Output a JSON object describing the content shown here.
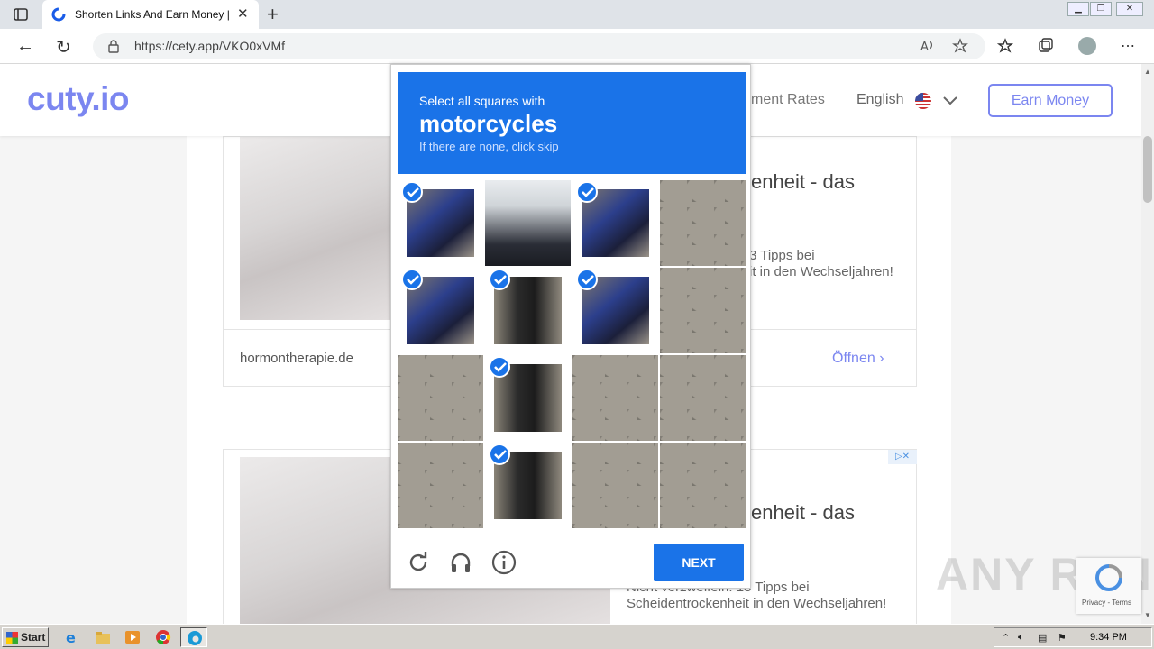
{
  "browser": {
    "tab_title": "Shorten Links And Earn Money | c",
    "url": "https://cety.app/VKO0xVMf",
    "window_controls": [
      "minimize-icon",
      "restore-icon",
      "close-icon"
    ]
  },
  "site": {
    "logo": "cuty.io",
    "nav_rates": "ment Rates",
    "nav_language": "English",
    "earn_button": "Earn Money",
    "brand_color": "#7b86f0"
  },
  "ads": [
    {
      "headline": "enheit - das",
      "text_line1": "3 Tipps bei",
      "text_line2": "it in den Wechseljahren!",
      "domain": "hormontherapie.de",
      "open_label": "Öffnen"
    },
    {
      "headline": "enheit - das",
      "text_line1": "Nicht verzweifeln: 13 Tipps bei",
      "text_line2": "Scheidentrockenheit in den Wechseljahren!"
    }
  ],
  "captcha": {
    "instruction": "Select all squares with",
    "target": "motorcycles",
    "hint": "If there are none, click skip",
    "next_button": "NEXT",
    "accent_color": "#1a73e8",
    "selected_tiles": [
      [
        0,
        0
      ],
      [
        0,
        2
      ],
      [
        1,
        0
      ],
      [
        1,
        1
      ],
      [
        1,
        2
      ],
      [
        2,
        1
      ],
      [
        3,
        1
      ]
    ],
    "footer_icons": [
      "reload-icon",
      "audio-icon",
      "info-icon"
    ]
  },
  "overlay": {
    "watermark": "ANY RUN",
    "recaptcha_links": "Privacy - Terms"
  },
  "taskbar": {
    "start_label": "Start",
    "clock": "9:34 PM",
    "apps": [
      "ie-icon",
      "explorer-icon",
      "media-player-icon",
      "chrome-icon",
      "edge-icon"
    ]
  }
}
